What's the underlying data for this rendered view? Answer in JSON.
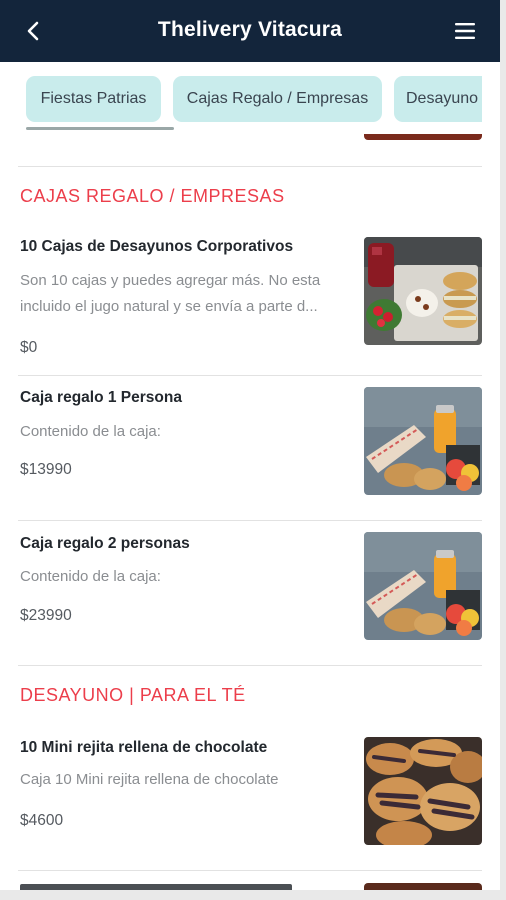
{
  "header": {
    "title": "Thelivery Vitacura",
    "back_icon": "chevron-left-icon",
    "menu_icon": "hamburger-menu-icon",
    "bg_color": "#13253b"
  },
  "tabs": [
    {
      "label": "Fiestas Patrias"
    },
    {
      "label": "Cajas Regalo / Empresas"
    },
    {
      "label": "Desayuno"
    }
  ],
  "sections": [
    {
      "title": "CAJAS REGALO / EMPRESAS",
      "items": [
        {
          "name": "10 Cajas de Desayunos Corporativos",
          "description": "Son 10 cajas y puedes agregar más. No esta incluido el jugo natural y se envía a parte d...",
          "price": "$0"
        },
        {
          "name": "Caja regalo 1 Persona",
          "description": "Contenido de la caja:",
          "price": "$13990"
        },
        {
          "name": "Caja regalo 2 personas",
          "description": "Contenido de la caja:",
          "price": "$23990"
        }
      ]
    },
    {
      "title": "DESAYUNO | PARA EL TÉ",
      "items": [
        {
          "name": "10 Mini rejita rellena de chocolate",
          "description": "Caja 10 Mini rejita rellena de chocolate",
          "price": "$4600"
        }
      ]
    }
  ],
  "accent_color": "#ec3e4b",
  "tab_color": "#c9ecec"
}
